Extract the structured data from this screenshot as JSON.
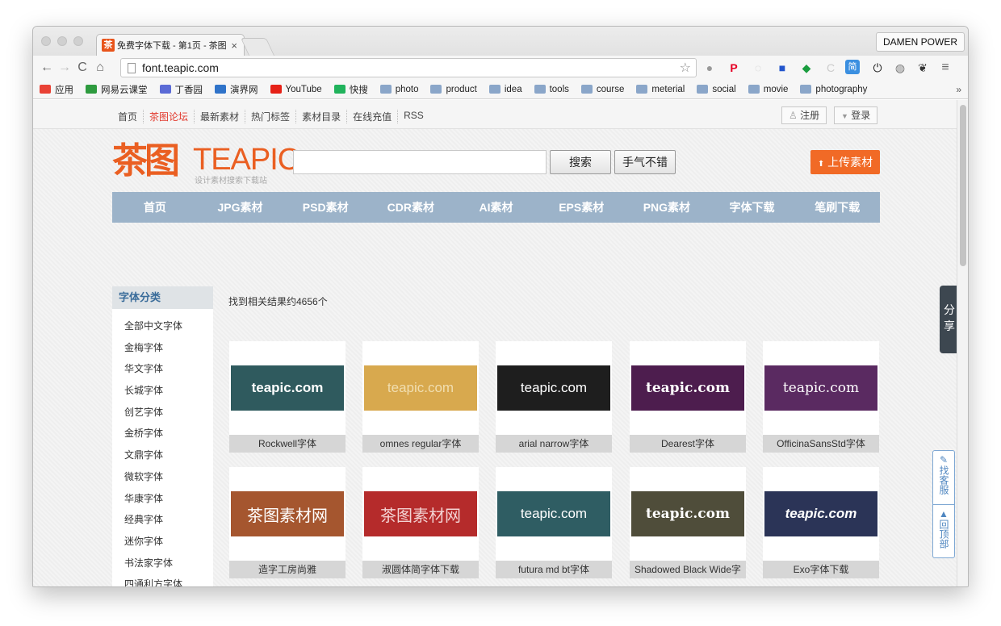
{
  "browser": {
    "tab_favicon": "茶",
    "tab_title": "免费字体下载 - 第1页 - 茶图",
    "tab_close": "×",
    "profile_name": "DAMEN POWER",
    "url": "font.teapic.com",
    "bookmarks": [
      {
        "label": "应用",
        "icon": "apps-grid-icon",
        "color": "#e94235"
      },
      {
        "label": "网易云课堂",
        "icon": "netease-class-icon",
        "color": "#2e9b3f"
      },
      {
        "label": "丁香园",
        "icon": "dxy-icon",
        "color": "#5b6bd6"
      },
      {
        "label": "演界网",
        "icon": "yanjie-icon",
        "color": "#2f73c9"
      },
      {
        "label": "YouTube",
        "icon": "youtube-icon",
        "color": "#e62117"
      },
      {
        "label": "快搜",
        "icon": "kuaisou-icon",
        "color": "#21b35c"
      },
      {
        "label": "photo",
        "icon": "folder-icon"
      },
      {
        "label": "product",
        "icon": "folder-icon"
      },
      {
        "label": "idea",
        "icon": "folder-icon"
      },
      {
        "label": "tools",
        "icon": "folder-icon"
      },
      {
        "label": "course",
        "icon": "folder-icon"
      },
      {
        "label": "meterial",
        "icon": "folder-icon"
      },
      {
        "label": "social",
        "icon": "folder-icon"
      },
      {
        "label": "movie",
        "icon": "folder-icon"
      },
      {
        "label": "photography",
        "icon": "folder-icon"
      }
    ],
    "bookmarks_more": "»"
  },
  "site": {
    "topnav": [
      "首页",
      "茶图论坛",
      "最新素材",
      "热门标签",
      "素材目录",
      "在线充值",
      "RSS"
    ],
    "register": "注册",
    "login": "登录",
    "logo_cn": "茶图",
    "logo_en": "TEAPIC",
    "logo_tagline": "设计素材搜索下载站",
    "search_placeholder": "",
    "search_button": "搜索",
    "lucky_button": "手气不错",
    "upload_button": "上传素材",
    "mainnav": [
      "首页",
      "JPG素材",
      "PSD素材",
      "CDR素材",
      "AI素材",
      "EPS素材",
      "PNG素材",
      "字体下载",
      "笔刷下载"
    ],
    "sidebar_title": "字体分类",
    "sidebar_items": [
      "全部中文字体",
      "金梅字体",
      "华文字体",
      "长城字体",
      "创艺字体",
      "金桥字体",
      "文鼎字体",
      "微软字体",
      "华康字体",
      "经典字体",
      "迷你字体",
      "书法家字体",
      "四通利方字体"
    ],
    "result_count": "找到相关结果约4656个",
    "cards": [
      {
        "caption": "Rockwell字体",
        "preview": "teapic.com",
        "bg": "#2f5a5e",
        "fg": "#ffffff"
      },
      {
        "caption": "omnes regular字体",
        "preview": "teapic.com",
        "bg": "#d8a94e",
        "fg": "#f1deb0"
      },
      {
        "caption": "arial narrow字体",
        "preview": "teapic.com",
        "bg": "#1e1e1e",
        "fg": "#ffffff"
      },
      {
        "caption": "Dearest字体",
        "preview": "teapic.com",
        "bg": "#4d1d4e",
        "fg": "#ffffff"
      },
      {
        "caption": "OfficinaSansStd字体",
        "preview": "teapic.com",
        "bg": "#5a2a61",
        "fg": "#ffffff"
      },
      {
        "caption": "造字工房尚雅",
        "preview": "茶图素材网",
        "bg": "#a5562f",
        "fg": "#ffffff"
      },
      {
        "caption": "淑圆体简字体下载",
        "preview": "茶图素材网",
        "bg": "#b52b2b",
        "fg": "#f3d3d3"
      },
      {
        "caption": "futura md bt字体",
        "preview": "teapic.com",
        "bg": "#2f5d63",
        "fg": "#ffffff"
      },
      {
        "caption": "Shadowed Black Wide字",
        "preview": "teapic.com",
        "bg": "#4f4d3a",
        "fg": "#ffffff"
      },
      {
        "caption": "Exo字体下载",
        "preview": "teapic.com",
        "bg": "#2b3457",
        "fg": "#ffffff"
      }
    ],
    "share_tab": "分享",
    "customer_service": "找客服",
    "back_to_top": "回顶部"
  },
  "colors": {
    "accent_orange": "#f16a26",
    "nav_blue": "#9cb3c9",
    "link_red": "#e23a2e"
  }
}
